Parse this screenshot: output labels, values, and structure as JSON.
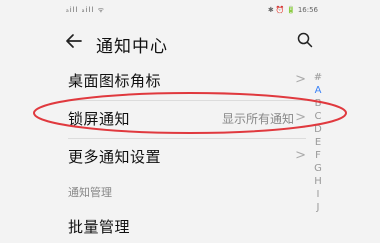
{
  "statusbar": {
    "left": "ₐill ₐill ᯤ",
    "right": "✱ ⏰ 🔋 16:56"
  },
  "appbar": {
    "title": "通知中心",
    "back_icon": "arrow-left-icon",
    "search_icon": "search-icon"
  },
  "settings": {
    "items": [
      {
        "label": "桌面图标角标",
        "value": ""
      },
      {
        "label": "锁屏通知",
        "value": "显示所有通知"
      },
      {
        "label": "更多通知设置",
        "value": ""
      }
    ],
    "section_title": "通知管理",
    "batch_manage": {
      "label": "批量管理"
    }
  },
  "index": {
    "letters": [
      "#",
      "A",
      "B",
      "C",
      "D",
      "E",
      "F",
      "G",
      "H",
      "I",
      "J"
    ],
    "active": "A"
  },
  "colors": {
    "background": "#f3f3f3",
    "highlight": "#e0393e",
    "index_active": "#3b82f6"
  }
}
